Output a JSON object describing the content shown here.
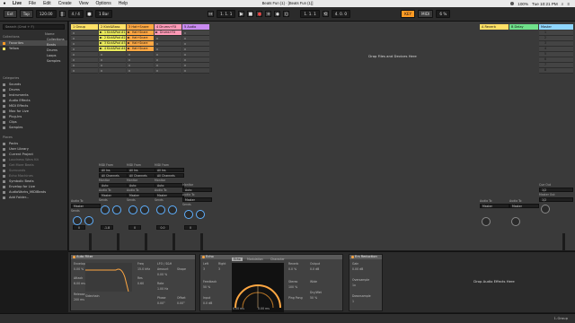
{
  "menubar": {
    "app": "Live",
    "items": [
      "File",
      "Edit",
      "Create",
      "View",
      "Options",
      "Help"
    ],
    "clock": "Tue 10:21 PM",
    "battery": "100%"
  },
  "window_title": "Beats Fun (1) · [Beats Fun (1)]",
  "transport": {
    "tap": "Tap",
    "tempo": "120.00",
    "sig": "4 / 4",
    "quant": "1 Bar",
    "pos": "1. 1. 1",
    "loop_start": "1. 1. 1",
    "loop_len": "4. 0. 0",
    "key": "KEY",
    "midi": "MIDI",
    "cpu": "6 %"
  },
  "browser": {
    "search_placeholder": "Search (Cmd + F)",
    "collections_label": "Collections",
    "collections": [
      "Favorites",
      "Yellow"
    ],
    "categories_label": "Categories",
    "categories": [
      "Sounds",
      "Drums",
      "Instruments",
      "Audio Effects",
      "MIDI Effects",
      "Max for Live",
      "Plug-Ins",
      "Clips",
      "Samples"
    ],
    "places_label": "Places",
    "places": [
      "Packs",
      "User Library",
      "Current Project",
      "Loudness Wars Kit",
      "Get More Beats"
    ],
    "places_dim": [
      "Surrounds",
      "Echo Machines"
    ],
    "places2": [
      "Symbolic Beats",
      "Envelop for Live",
      "AudioWorks_MIDIBeats",
      "Add Folder..."
    ],
    "name_header": "Name",
    "list": [
      "Collections",
      "Beats",
      "Drums",
      "Loops",
      "Samples"
    ]
  },
  "tracks": [
    {
      "name": "1 Group",
      "color": "#ffe066"
    },
    {
      "name": "2 Kick&Bass",
      "color": "#ffe066"
    },
    {
      "name": "3 Hat+Snare",
      "color": "#ffa742"
    },
    {
      "name": "4 Drums+FX",
      "color": "#ff9ab7"
    },
    {
      "name": "5 Audio",
      "color": "#c88af0"
    }
  ],
  "return_tracks": [
    {
      "name": "A Reverb",
      "color": "#ffe066"
    },
    {
      "name": "B Delay",
      "color": "#6fe08a"
    },
    {
      "name": "Master",
      "color": "#8fd6ff"
    }
  ],
  "clips_track2": [
    "1 Kick&Pad #1",
    "2 Kick&Pad #2",
    "3 Kick&Pad #3",
    "4 Kick&Pad #4"
  ],
  "clips_track3": [
    "Hat+Snare",
    "Hat+Snare",
    "Hat+Snare",
    "Hat+Snare"
  ],
  "clips_track4": [
    "Drums+FX"
  ],
  "master_slots": [
    "1",
    "2",
    "3",
    "4",
    "5",
    "6",
    "7",
    "8"
  ],
  "drop_label": "Drop Files and Devices Here",
  "drop_fx_label": "Drop Audio Effects Here",
  "mixer": {
    "midi_from": "MIDI From",
    "all_ins": "All Ins",
    "all_channels": "All Channels",
    "monitor": "Monitor",
    "in": "In",
    "auto": "Auto",
    "off": "Off",
    "audio_to": "Audio To",
    "master": "Master",
    "sends": "Sends",
    "cue_out": "Cue Out",
    "cue_val": "1/2",
    "master_out": "Master Out",
    "master_out_val": "1/2",
    "volumes": [
      "0",
      "-1.8",
      "0",
      "0.0",
      "0"
    ],
    "numbers": [
      "1",
      "2",
      "3",
      "4",
      "5"
    ],
    "solo": "S"
  },
  "devices": {
    "auto_filter": {
      "name": "Auto Filter",
      "labels": [
        "Envelope",
        "Attack",
        "Release",
        "Freq",
        "Res",
        "LFO / S&H",
        "Amount",
        "Shape",
        "Rate",
        "Phase",
        "Offset",
        "Quantize",
        "Sidechain"
      ],
      "values": [
        "0.00 %",
        "6.00 ms",
        "200 ms",
        "15.0 kHz",
        "0.60",
        "0.00 %",
        "0.50",
        "1.00 Hz",
        "0.00°",
        "0.00°"
      ]
    },
    "echo": {
      "name": "Echo",
      "tabs": [
        "Echo",
        "Modulation",
        "Character"
      ],
      "left_label": "Left",
      "left_val": "3",
      "right_label": "Right",
      "right_val": "3",
      "feedback_label": "Feedback",
      "feedback_val": "50 %",
      "input_label": "Input",
      "input_val": "0.0 dB",
      "reverb_label": "Reverb",
      "reverb_val": "0.0 %",
      "stereo_label": "Stereo",
      "stereo_val": "100 %",
      "output_label": "Output",
      "output_val": "0.0 dB",
      "dry_wet_label": "Dry/Wet",
      "dry_wet_val": "50 %",
      "ping_pong": "Ping Pong",
      "wide": "Wide",
      "screen_left": "0.00 ms",
      "screen_right": "0.00 ms"
    },
    "ers": {
      "name": "Ers Reduction",
      "labels": [
        "Gain",
        "Oversample",
        "Downsample"
      ],
      "values": [
        "0.00 dB",
        "1x",
        "1"
      ]
    }
  },
  "status": {
    "right": "1-Group"
  }
}
